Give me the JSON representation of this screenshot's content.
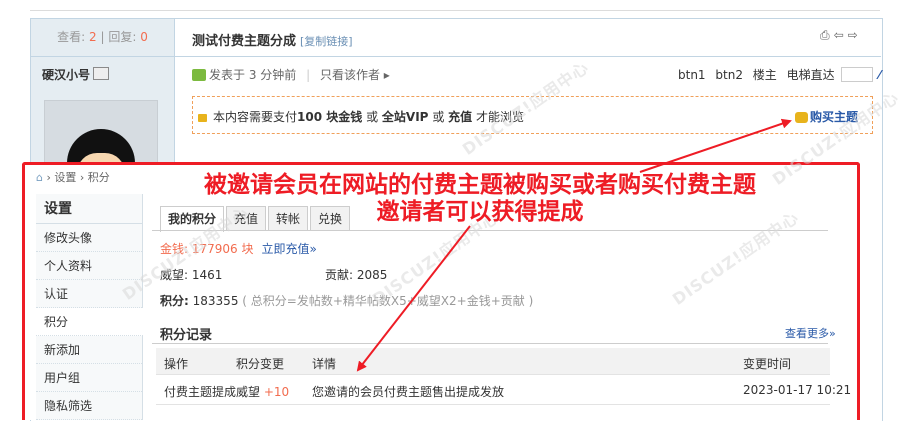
{
  "stats": {
    "views_label": "查看:",
    "views": "2",
    "replies_label": "回复:",
    "replies": "0"
  },
  "author": {
    "name": "硬汉小号"
  },
  "thread": {
    "title": "测试付费主题分成",
    "copy_link": "[复制链接]"
  },
  "post": {
    "posted": "发表于 3 分钟前",
    "only_author": "只看该作者 ▸",
    "btn1": "btn1",
    "btn2": "btn2",
    "owner": "楼主",
    "floor_jump": "电梯直达"
  },
  "paywall": {
    "prefix": "本内容需要支付",
    "amount": "100 块金钱",
    "or1": "或",
    "vip": "全站VIP",
    "or2": "或",
    "recharge": "充值",
    "suffix": "才能浏览",
    "buy": "购买主题"
  },
  "overlay": {
    "breadcrumb": [
      "设置",
      "积分"
    ],
    "menu_title": "设置",
    "menu": [
      "修改头像",
      "个人资料",
      "认证",
      "积分",
      "新添加",
      "用户组",
      "隐私筛选"
    ],
    "menu_active_index": 3,
    "tabs": [
      "我的积分",
      "充值",
      "转帐",
      "兑换"
    ],
    "gold": "金钱: 177906 块",
    "recharge_link": "立即充值»",
    "prestige": "威望: 1461",
    "contribution": "贡献: 2085",
    "score_label": "积分:",
    "score_value": "183355",
    "score_formula": "( 总积分=发帖数+精华帖数X5+威望X2+金钱+贡献 )",
    "records_title": "积分记录",
    "more": "查看更多»",
    "columns": [
      "操作",
      "积分变更",
      "详情",
      "变更时间"
    ],
    "rows": [
      {
        "action": "付费主题提成",
        "change_type": "威望",
        "change_value": "+10",
        "detail": "您邀请的会员付费主题售出提成发放",
        "time": "2023-01-17 10:21"
      }
    ]
  },
  "annotation": {
    "line1": "被邀请会员在网站的付费主题被购买或者购买付费主题",
    "line2": "邀请者可以获得提成"
  },
  "watermark": "DISCUZ!应用中心",
  "colors": {
    "annotation_red": "#ee1c25",
    "link_blue": "#2a5aa8",
    "accent_orange": "#f26c4f",
    "border_blue": "#c2d5e3"
  }
}
